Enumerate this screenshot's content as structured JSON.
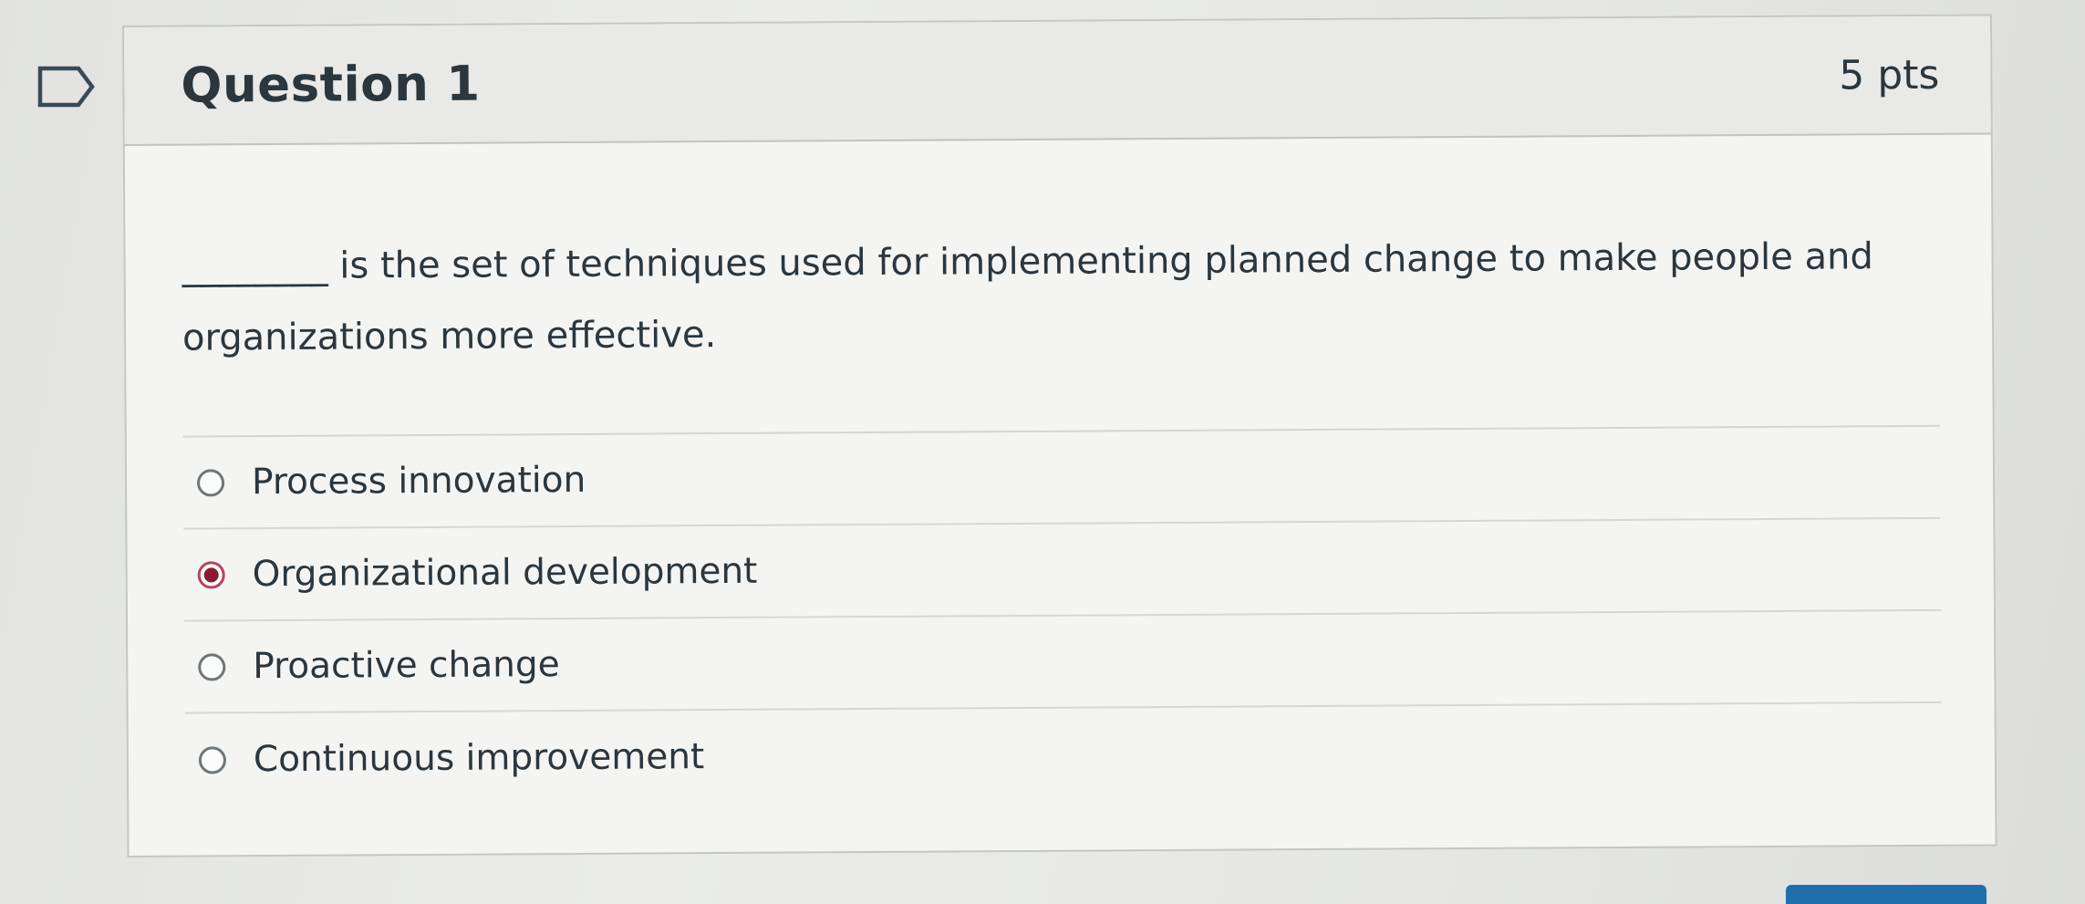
{
  "question": {
    "title": "Question 1",
    "points": "5 pts",
    "text": "________ is the set of techniques used for implementing planned change to make people and organizations more effective."
  },
  "answers": [
    {
      "label": "Process innovation",
      "selected": false
    },
    {
      "label": "Organizational development",
      "selected": true
    },
    {
      "label": "Proactive change",
      "selected": false
    },
    {
      "label": "Continuous improvement",
      "selected": false
    }
  ],
  "icons": {
    "flag": "bookmark-flag-icon",
    "radio_unselected": "radio-empty-icon",
    "radio_selected": "radio-filled-icon"
  },
  "colors": {
    "selected_radio": "#8a1a33",
    "header_background": "#e9eae8",
    "submit_button": "#1f6fad"
  }
}
